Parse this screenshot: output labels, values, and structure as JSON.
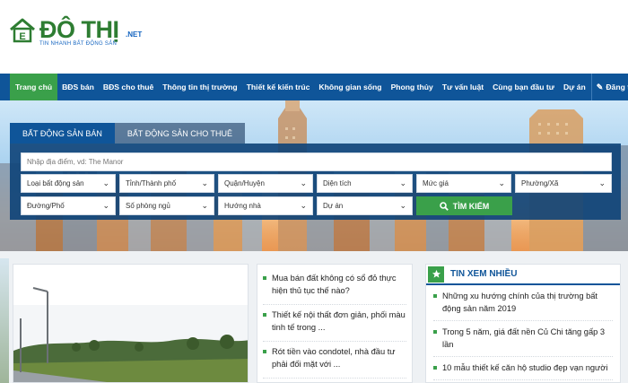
{
  "logo": {
    "main": "ĐÔ THỊ",
    "suffix": ".NET",
    "tagline": "TIN NHANH BẤT ĐỘNG SẢN"
  },
  "nav": {
    "items": [
      "Trang chủ",
      "BĐS bán",
      "BĐS cho thuê",
      "Thông tin thị trường",
      "Thiết kế kiến trúc",
      "Không gian sống",
      "Phong thủy",
      "Tư vấn luật",
      "Cùng bạn đầu tư",
      "Dự án"
    ],
    "login": "Đăng tin"
  },
  "search": {
    "tabs": [
      "BẤT ĐỘNG SẢN BÁN",
      "BẤT ĐỘNG SẢN CHO THUÊ"
    ],
    "placeholder": "Nhập địa điểm, vd: The Manor",
    "selects_row1": [
      "Loại bất động sản",
      "Tỉnh/Thành phố",
      "Quận/Huyện",
      "Diện tích",
      "Mức giá",
      "Phường/Xã"
    ],
    "selects_row2": [
      "Đường/Phố",
      "Số phòng ngủ",
      "Hướng nhà",
      "Dự án"
    ],
    "button": "TÌM KIẾM"
  },
  "news": [
    "Mua bán đất không có sổ đỏ thực hiện thủ tục thế nào?",
    "Thiết kế nội thất đơn giản, phối màu tinh tế trong ...",
    "Rót tiền vào condotel, nhà đầu tư phải đối mặt với ..."
  ],
  "most_viewed": {
    "title": "TIN XEM NHIỀU",
    "items": [
      "Những xu hướng chính của thị trường bất động sản năm 2019",
      "Trong 5 năm, giá đất nền Củ Chi tăng gấp 3 lần",
      "10 mẫu thiết kế căn hộ studio đẹp vạn người"
    ]
  },
  "colors": {
    "brand_blue": "#0f5599",
    "brand_green": "#3aa04a"
  }
}
